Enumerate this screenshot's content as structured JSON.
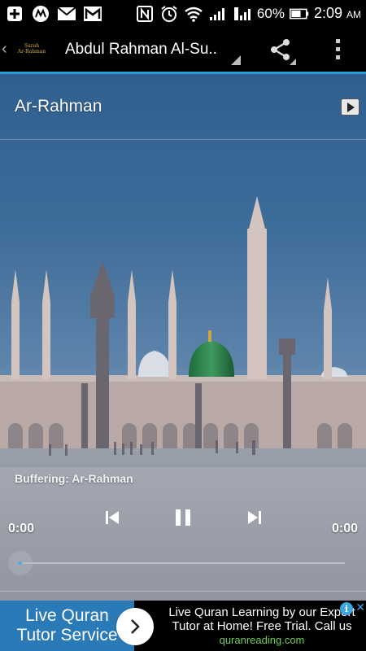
{
  "status_bar": {
    "battery": "60%",
    "time": "2:09",
    "ampm": "AM",
    "icons": [
      "add-icon",
      "app-icon",
      "mail-icon",
      "gmail-icon",
      "nfc-icon",
      "alarm-icon",
      "wifi-icon",
      "signal-icon",
      "roaming-signal-icon",
      "battery-icon"
    ]
  },
  "action_bar": {
    "logo_line1": "Surah",
    "logo_line2": "Ar-Rahman",
    "title": "Abdul Rahman Al-Su..",
    "share_icon": "share-icon",
    "overflow_icon": "overflow-menu-icon"
  },
  "track": {
    "title": "Ar-Rahman"
  },
  "player": {
    "status": "Buffering: Ar-Rahman",
    "time_elapsed": "0:00",
    "time_total": "0:00",
    "progress": 0,
    "controls": [
      "previous-icon",
      "pause-icon",
      "next-icon"
    ]
  },
  "ad": {
    "headline": "Live Quran Tutor Service",
    "description": "Live Quran Learning by our Expert Tutor at Home! Free Trial. Call us",
    "url": "quranreading.com",
    "info_glyph": "i"
  },
  "colors": {
    "accent": "#2a9fd6",
    "ad_left_bg": "#2a7ab8",
    "ad_url": "#6fcf5a"
  }
}
